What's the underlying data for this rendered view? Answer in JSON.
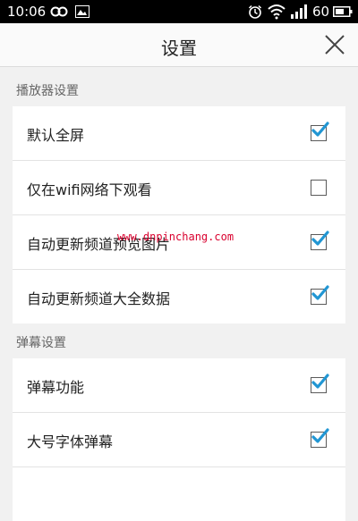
{
  "status_bar": {
    "time": "10:06",
    "battery": "60"
  },
  "header": {
    "title": "设置"
  },
  "sections": [
    {
      "label": "播放器设置",
      "items": [
        {
          "label": "默认全屏",
          "checked": true
        },
        {
          "label": "仅在wifi网络下观看",
          "checked": false
        },
        {
          "label": "自动更新频道预览图片",
          "checked": true
        },
        {
          "label": "自动更新频道大全数据",
          "checked": true
        }
      ]
    },
    {
      "label": "弹幕设置",
      "items": [
        {
          "label": "弹幕功能",
          "checked": true
        },
        {
          "label": "大号字体弹幕",
          "checked": true
        }
      ]
    }
  ],
  "watermark": "www.dnpinchang.com",
  "colors": {
    "check": "#2196d3",
    "status_bar": "#000000",
    "background": "#f1f1f1"
  }
}
